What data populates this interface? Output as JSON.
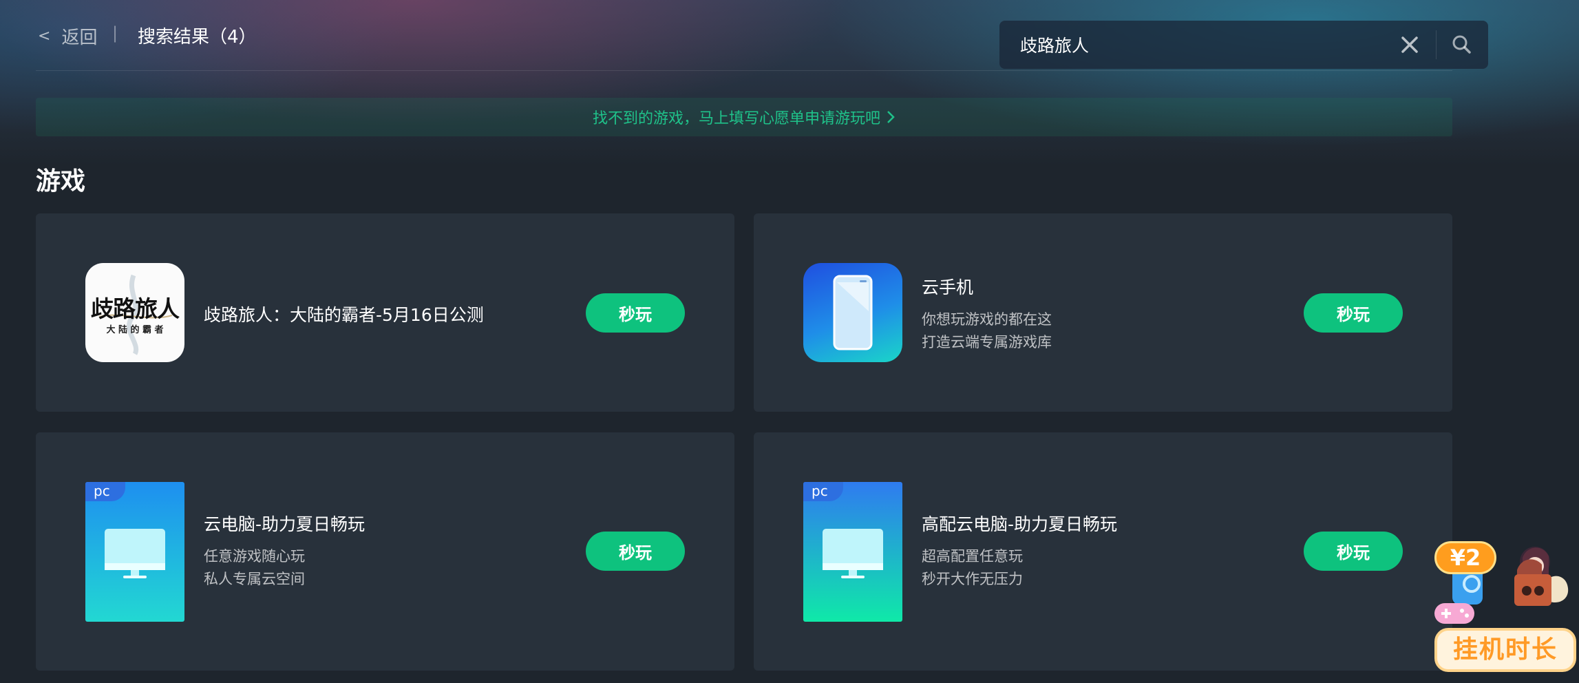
{
  "header": {
    "back_label": "返回",
    "separator": "|",
    "result_title": "搜索结果（4）",
    "search": {
      "value": "歧路旅人",
      "placeholder": ""
    }
  },
  "banner": {
    "text": "找不到的游戏，马上填写心愿单申请游玩吧"
  },
  "section": {
    "title": "游戏"
  },
  "games": [
    {
      "name": "歧路旅人：大陆的霸者-5月16日公测",
      "desc": [],
      "button": "秒玩",
      "icon": "octopath-logo-icon",
      "icon_text_main": "歧路旅人",
      "icon_text_sub": "大 陆 的 霸 者"
    },
    {
      "name": "云手机",
      "desc": [
        "你想玩游戏的都在这",
        "打造云端专属游戏库"
      ],
      "button": "秒玩",
      "icon": "phone-icon"
    },
    {
      "name": "云电脑-助力夏日畅玩",
      "desc": [
        "任意游戏随心玩",
        "私人专属云空间"
      ],
      "button": "秒玩",
      "icon": "monitor-icon",
      "tag": "pc"
    },
    {
      "name": "高配云电脑-助力夏日畅玩",
      "desc": [
        "超高配置任意玩",
        "秒开大作无压力"
      ],
      "button": "秒玩",
      "icon": "monitor-icon",
      "tag": "pc"
    }
  ],
  "float_ad": {
    "price": "¥2",
    "label": "挂机时长",
    "icon": "gamepad-icon"
  },
  "colors": {
    "accent": "#0ec27e",
    "card_bg": "#28313b",
    "page_bg": "#1e252d",
    "banner_text": "#1fc28a"
  }
}
